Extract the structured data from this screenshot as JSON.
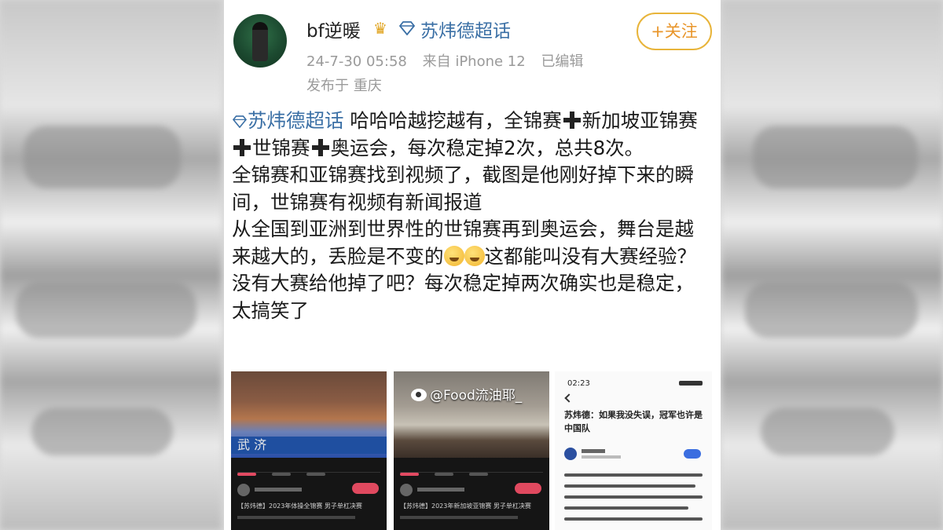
{
  "post": {
    "username": "bf逆暖",
    "crown_icon": "crown-icon",
    "topic_top": "苏炜德超话",
    "follow_label": "+关注",
    "date": "24-7-30 05:58",
    "source": "来自 iPhone 12",
    "edited": "已编辑",
    "location": "发布于 重庆",
    "topic_link": "苏炜德超话",
    "body": {
      "seg1": " 哈哈哈越挖越有，全锦赛",
      "seg2": "新加坡亚锦赛",
      "seg3": "世锦赛",
      "seg4": "奥运会，每次稳定掉2次，总共8次。",
      "line2": "全锦赛和亚锦赛找到视频了，截图是他刚好掉下来的瞬间，世锦赛有视频有新闻报道",
      "line3a": "从全国到亚洲到世界性的世锦赛再到奥运会，舞台是越来越大的，丢脸是不变的",
      "line3b": "这都能叫没有大赛经验？没有大赛给他掉了吧？每次稳定掉两次确实也是稳定，太搞笑了"
    }
  },
  "images": {
    "img1": {
      "banner": "武 济",
      "caption": "【苏炜德】2023年体操全锦赛 男子单杠决赛"
    },
    "img2": {
      "watermark": "@Food流油耶_",
      "caption": "【苏炜德】2023年新加坡亚锦赛 男子单杠决赛"
    },
    "img3": {
      "time": "02:23",
      "headline": "苏炜德：如果我没失误，冠军也许是中国队"
    }
  },
  "colors": {
    "topic": "#3a6fa5",
    "follow": "#e8952a",
    "meta": "#9a9a9a"
  }
}
